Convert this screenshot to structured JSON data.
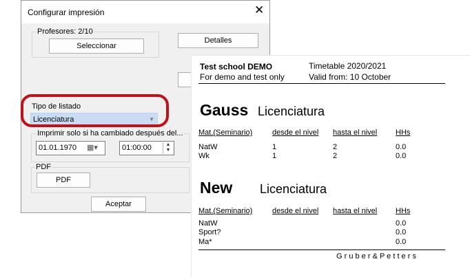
{
  "dialog": {
    "title": "Configurar impresión",
    "close_glyph": "✕",
    "profesores_label": "Profesores: 2/10",
    "seleccionar_button": "Seleccionar",
    "detalles_button": "Detalles",
    "tipo_label": "Tipo de listado",
    "tipo_value": "Licenciatura",
    "imprimir_label": "Imprimir solo si ha cambiado después del...",
    "date_value": "01.01.1970",
    "time_value": "01:00:00",
    "pdf_group_label": "PDF",
    "pdf_button": "PDF",
    "aceptar_button": "Aceptar"
  },
  "report": {
    "school": "Test school  DEMO",
    "school_sub": "For demo and test only",
    "timetable": "Timetable 2020/2021",
    "valid_from": "Valid from: 10 October",
    "headers": [
      "Mat.(Seminario)",
      "desde el nivel",
      "hasta el nivel",
      "HHs"
    ],
    "sections": [
      {
        "name": "Gauss",
        "type": "Licenciatura",
        "rows": [
          [
            "NatW",
            "1",
            "2",
            "0.0"
          ],
          [
            "Wk",
            "1",
            "2",
            "0.0"
          ]
        ]
      },
      {
        "name": "New",
        "type": "Licenciatura",
        "rows": [
          [
            "NatW",
            "",
            "",
            "0.0"
          ],
          [
            "Sport?",
            "",
            "",
            "0.0"
          ],
          [
            "Ma*",
            "",
            "",
            "0.0"
          ]
        ]
      }
    ],
    "footer": "G r u b e r   &   P e t t e r s"
  }
}
